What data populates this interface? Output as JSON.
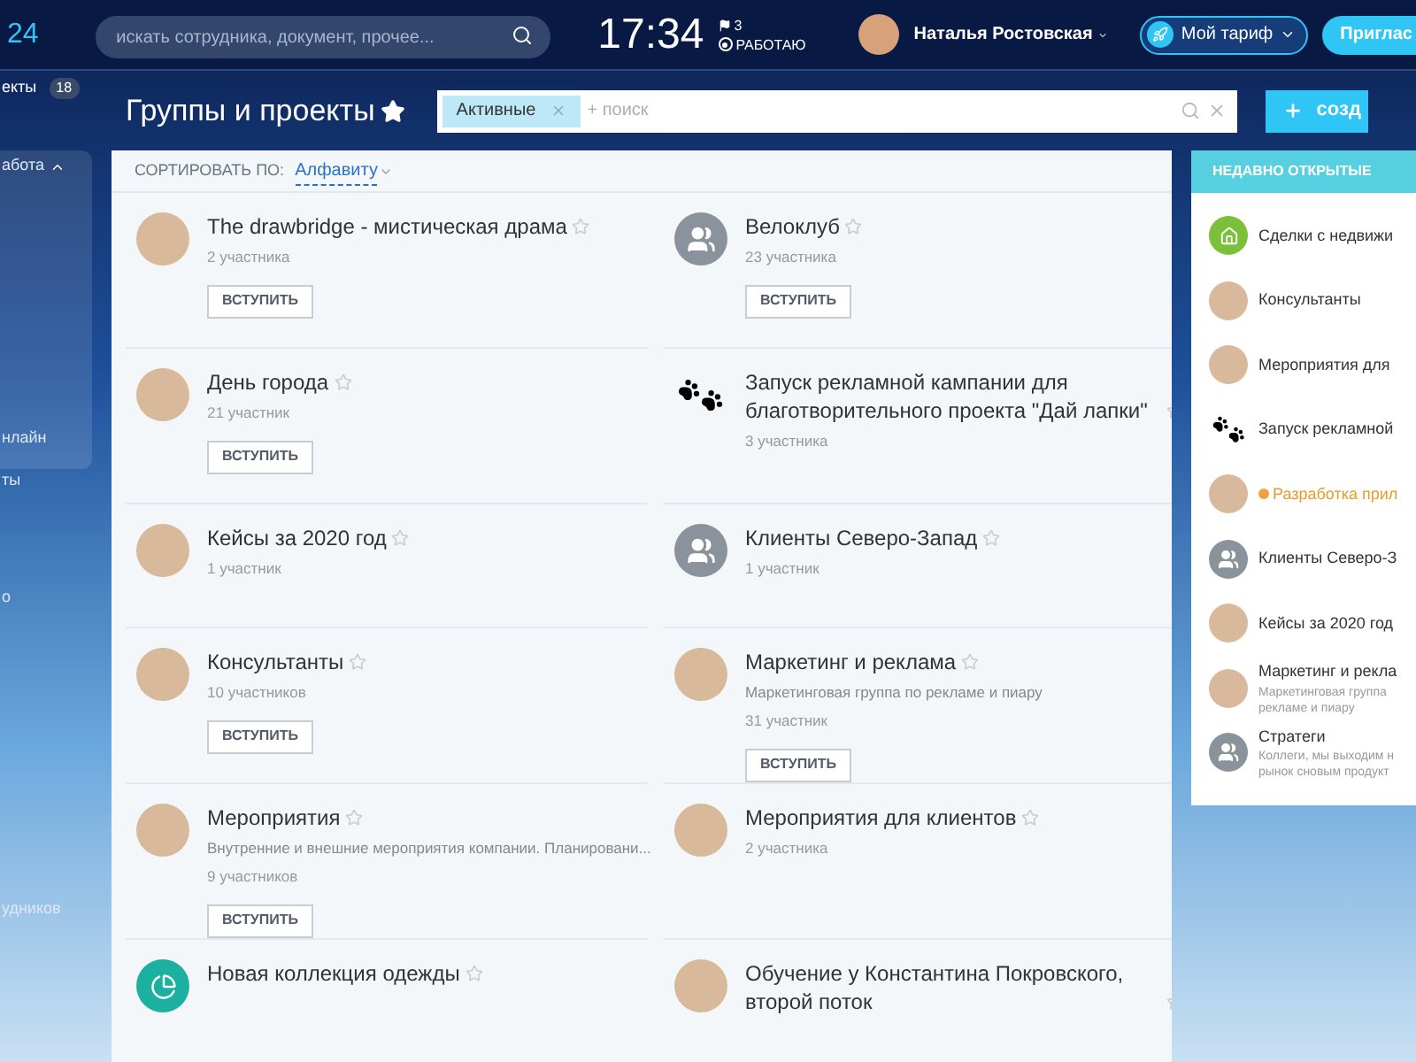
{
  "topbar": {
    "logo": "24",
    "search": {
      "placeholder": "искать сотрудника, документ, прочее..."
    },
    "time": "17:34",
    "flags": "3",
    "status": "РАБОТАЮ",
    "user": "Наталья Ростовская",
    "tariff": "Мой тариф",
    "invite": "Приглас"
  },
  "sidebar": {
    "items": [
      {
        "label": "екты",
        "badge": "18"
      },
      {
        "label": "абота",
        "expanded": true
      },
      {
        "label": "нлайн"
      },
      {
        "label": "ты"
      },
      {
        "label": "о"
      },
      {
        "label": "удников"
      }
    ]
  },
  "header": {
    "title": "Группы и проекты",
    "filter": {
      "tag": "Активные",
      "placeholder": "+ поиск"
    },
    "create": "созд"
  },
  "sort": {
    "label": "СОРТИРОВАТЬ ПО:",
    "value": "Алфавиту"
  },
  "rows": [
    {
      "groups": [
        {
          "title": "The drawbridge - мистическая драма",
          "kind": "photo",
          "members": "2 участника",
          "join": "ВСТУПИТЬ"
        },
        {
          "title": "Велоклуб",
          "kind": "group",
          "members": "23 участника",
          "join": "ВСТУПИТЬ"
        }
      ]
    },
    {
      "groups": [
        {
          "title": "День города",
          "kind": "photo",
          "members": "21 участник",
          "join": "ВСТУПИТЬ"
        },
        {
          "title": "Запуск рекламной кампании для благотворительного проекта \"Дай лапки\"",
          "kind": "paws",
          "members": "3 участника"
        }
      ]
    },
    {
      "groups": [
        {
          "title": "Кейсы за 2020 год",
          "kind": "photo",
          "members": "1 участник"
        },
        {
          "title": "Клиенты Северо-Запад",
          "kind": "group",
          "members": "1 участник"
        }
      ]
    },
    {
      "groups": [
        {
          "title": "Консультанты",
          "kind": "photo",
          "members": "10 участников",
          "join": "ВСТУПИТЬ"
        },
        {
          "title": "Маркетинг и реклама",
          "kind": "photo",
          "description": "Маркетинговая группа по рекламе и пиару",
          "members": "31 участник",
          "join": "ВСТУПИТЬ"
        }
      ]
    },
    {
      "groups": [
        {
          "title": "Мероприятия",
          "kind": "photo",
          "description": "Внутренние и внешние мероприятия компании. Планировани...",
          "members": "9 участников",
          "join": "ВСТУПИТЬ"
        },
        {
          "title": "Мероприятия для клиентов",
          "kind": "photo",
          "members": "2 участника"
        }
      ]
    },
    {
      "groups": [
        {
          "title": "Новая коллекция одежды",
          "kind": "pie"
        },
        {
          "title": "Обучение у Константина Покровского, второй поток",
          "kind": "photo"
        }
      ]
    }
  ],
  "recent": {
    "title": "НЕДАВНО ОТКРЫТЫЕ",
    "items": [
      {
        "title": "Сделки с недвижи",
        "kind": "home",
        "highlighted": false
      },
      {
        "title": "Консультанты",
        "kind": "photo",
        "highlighted": false
      },
      {
        "title": "Мероприятия для",
        "kind": "photo",
        "highlighted": false
      },
      {
        "title": "Запуск рекламной",
        "kind": "paws",
        "highlighted": false
      },
      {
        "title": "Разработка прил",
        "kind": "photo",
        "highlighted": true
      },
      {
        "title": "Клиенты Северо-З",
        "kind": "group",
        "highlighted": false
      },
      {
        "title": "Кейсы за 2020 год",
        "kind": "photo",
        "highlighted": false
      },
      {
        "title": "Маркетинг и рекла",
        "kind": "photo",
        "highlighted": false,
        "description": [
          "Маркетинговая группа",
          "рекламе и пиару"
        ]
      },
      {
        "title": "Стратеги",
        "kind": "group",
        "highlighted": false,
        "description": [
          "Коллеги, мы выходим н",
          "рынок сновым продукт"
        ]
      }
    ]
  }
}
